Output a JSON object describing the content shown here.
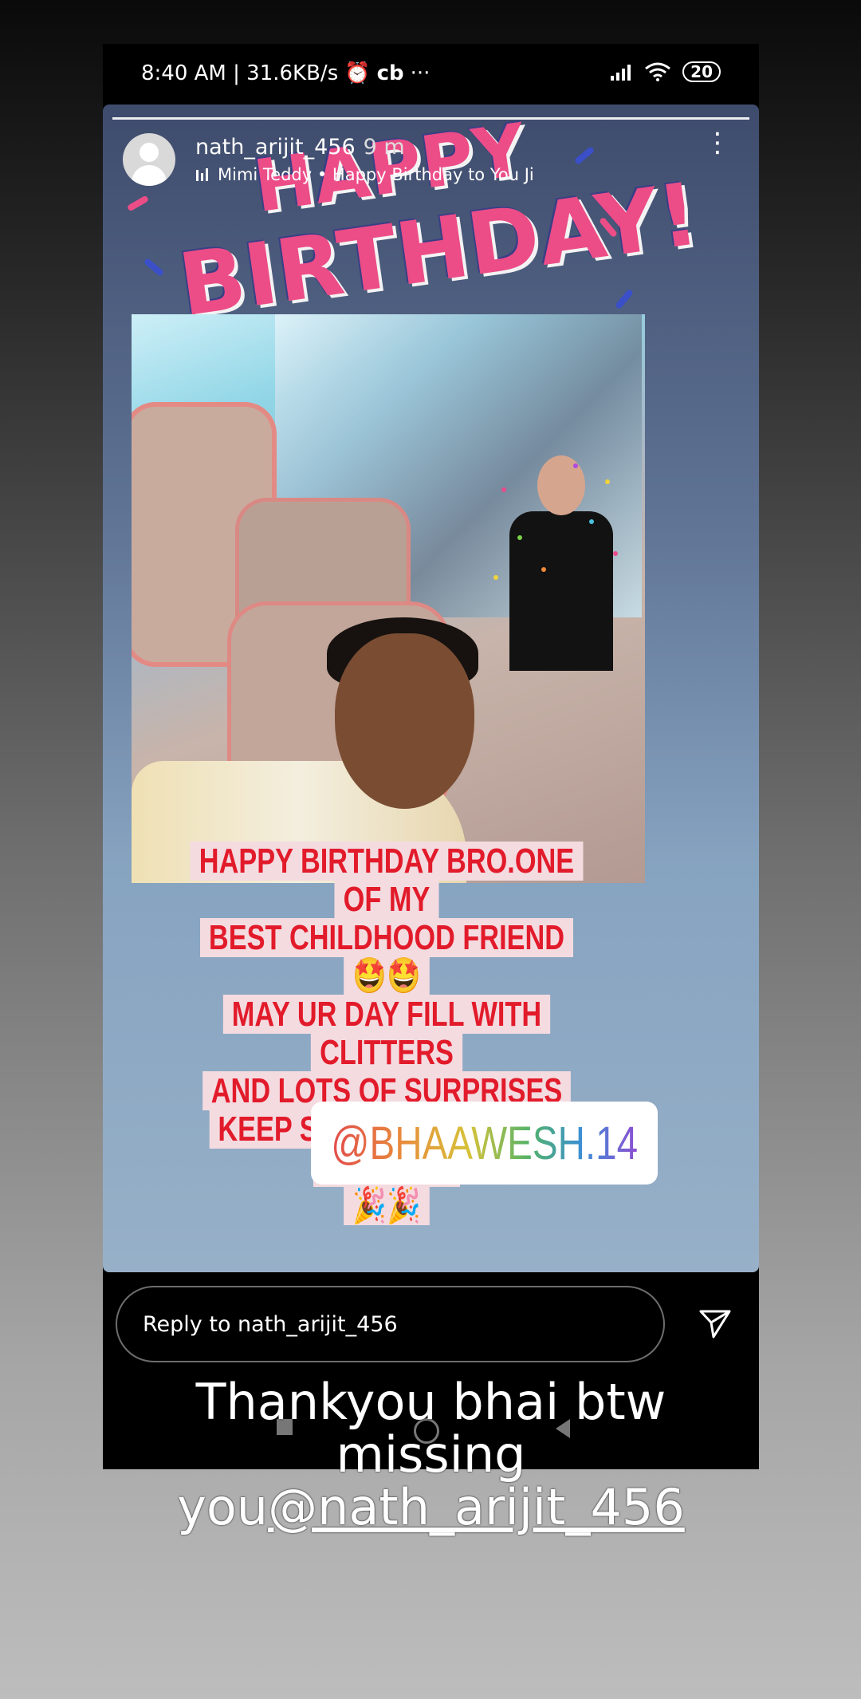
{
  "status_bar": {
    "time_speed": "8:40 AM | 31.6KB/s",
    "app_indicator": "cb",
    "overflow": "···",
    "battery": "20"
  },
  "story": {
    "username": "nath_arijit_456",
    "time_ago": "9 m",
    "music": "Mimi Teddy • Happy Birthday to You Ji",
    "sticker_line1": "HAPPY",
    "sticker_line2": "BIRTHDAY!",
    "message_lines": [
      "HAPPY BIRTHDAY BRO.ONE OF MY",
      "BEST CHILDHOOD FRIEND 🤩🤩",
      "MAY UR DAY FILL WITH  CLITTERS",
      "AND LOTS OF SURPRISES",
      "KEEP SMILING AND STAY BLESSED",
      "🎉🎉"
    ],
    "mention": "@BHAAWESH.14"
  },
  "reply": {
    "placeholder": "Reply to nath_arijit_456"
  },
  "caption": {
    "text": "Thankyou bhai btw missing you",
    "handle": "@nath_arijit_456"
  },
  "colors": {
    "sticker_pink": "#ec4d87",
    "message_red": "#e21b2b"
  }
}
